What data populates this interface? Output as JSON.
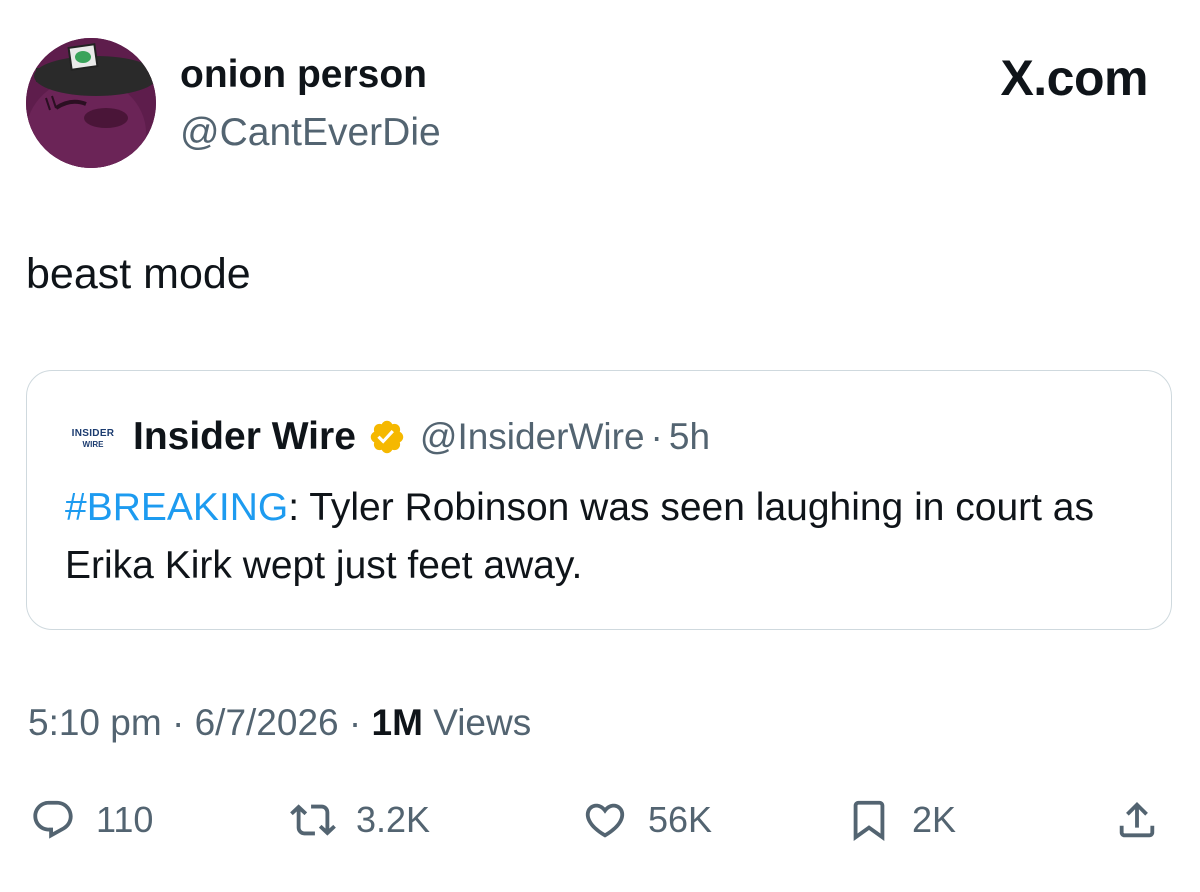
{
  "post": {
    "author_name": "onion person",
    "author_handle": "@CantEverDie",
    "brand": "X.com",
    "text": "beast mode",
    "timestamp": "5:10 pm",
    "date": "6/7/2026",
    "views_count": "1M",
    "views_label": "Views"
  },
  "quote": {
    "logo_line1": "INSIDER",
    "logo_line2": "WIRE",
    "name": "Insider Wire",
    "handle": "@InsiderWire",
    "age": "5h",
    "hashtag": "#BREAKING",
    "text": ": Tyler Robinson was seen laughing in court as Erika Kirk wept just feet away.",
    "verified_badge_color": "#f5b800"
  },
  "actions": {
    "replies": "110",
    "reposts": "3.2K",
    "likes": "56K",
    "bookmarks": "2K"
  },
  "colors": {
    "text": "#0f1419",
    "secondary": "#536471",
    "link": "#1d9bf0",
    "border": "#cfd9de"
  },
  "icons": [
    "reply-icon",
    "repost-icon",
    "like-icon",
    "bookmark-icon",
    "share-icon",
    "verified-icon"
  ]
}
